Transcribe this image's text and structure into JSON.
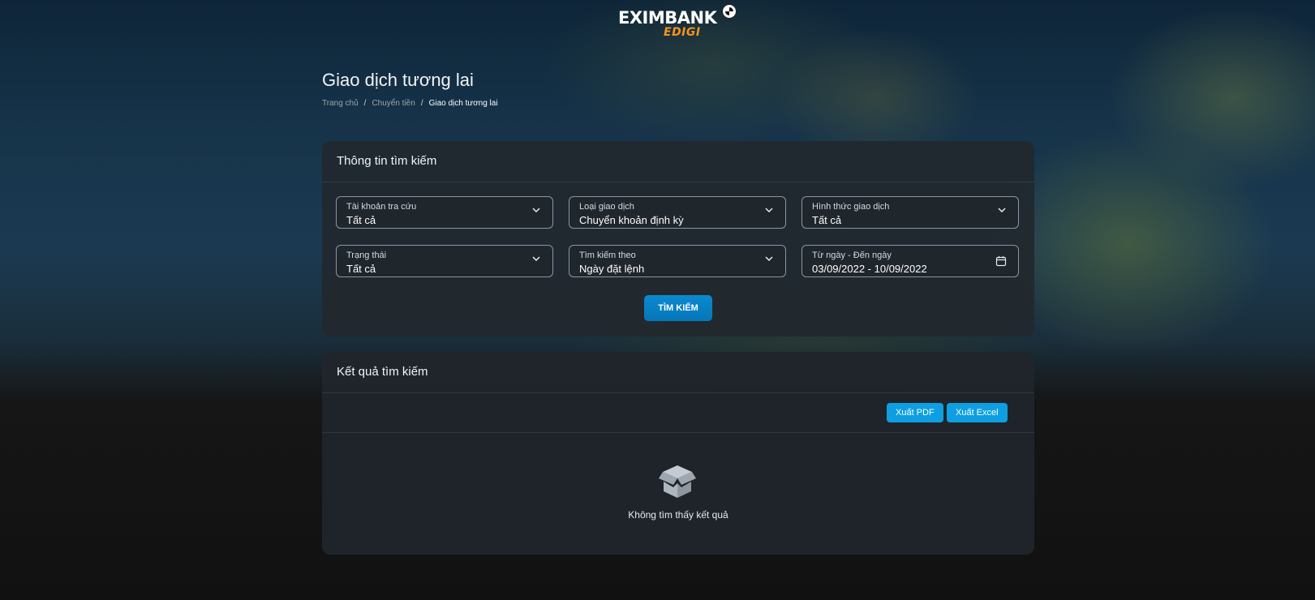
{
  "brand": {
    "logo_main": "EXIMBANK",
    "logo_sub": "EDIGI",
    "accent_color": "#f7941d"
  },
  "page": {
    "title": "Giao dịch tương lai",
    "breadcrumb": [
      "Trang chủ",
      "Chuyển tiền",
      "Giao dịch tương lai"
    ],
    "breadcrumb_separator": "/"
  },
  "search": {
    "header": "Thông tin tìm kiếm",
    "fields": [
      {
        "label": "Tài khoản tra cứu",
        "value": "Tất cả",
        "icon": "chevron-down-icon"
      },
      {
        "label": "Loại giao dịch",
        "value": "Chuyển khoản định kỳ",
        "icon": "chevron-down-icon"
      },
      {
        "label": "Hình thức giao dịch",
        "value": "Tất cả",
        "icon": "chevron-down-icon"
      },
      {
        "label": "Trạng thái",
        "value": "Tất cả",
        "icon": "chevron-down-icon"
      },
      {
        "label": "Tìm kiếm theo",
        "value": "Ngày đặt lệnh",
        "icon": "chevron-down-icon"
      },
      {
        "label": "Từ ngày - Đến ngày",
        "value": "03/09/2022 - 10/09/2022",
        "icon": "calendar-icon"
      }
    ],
    "button_label": "TÌM KIẾM",
    "button_color": "#0a8ad0"
  },
  "results": {
    "header": "Kết quả tìm kiếm",
    "export_pdf": "Xuất PDF",
    "export_excel": "Xuất Excel",
    "export_color": "#0e9fe2",
    "empty_icon": "empty-box-icon",
    "empty_text": "Không tìm thấy kết quả"
  }
}
